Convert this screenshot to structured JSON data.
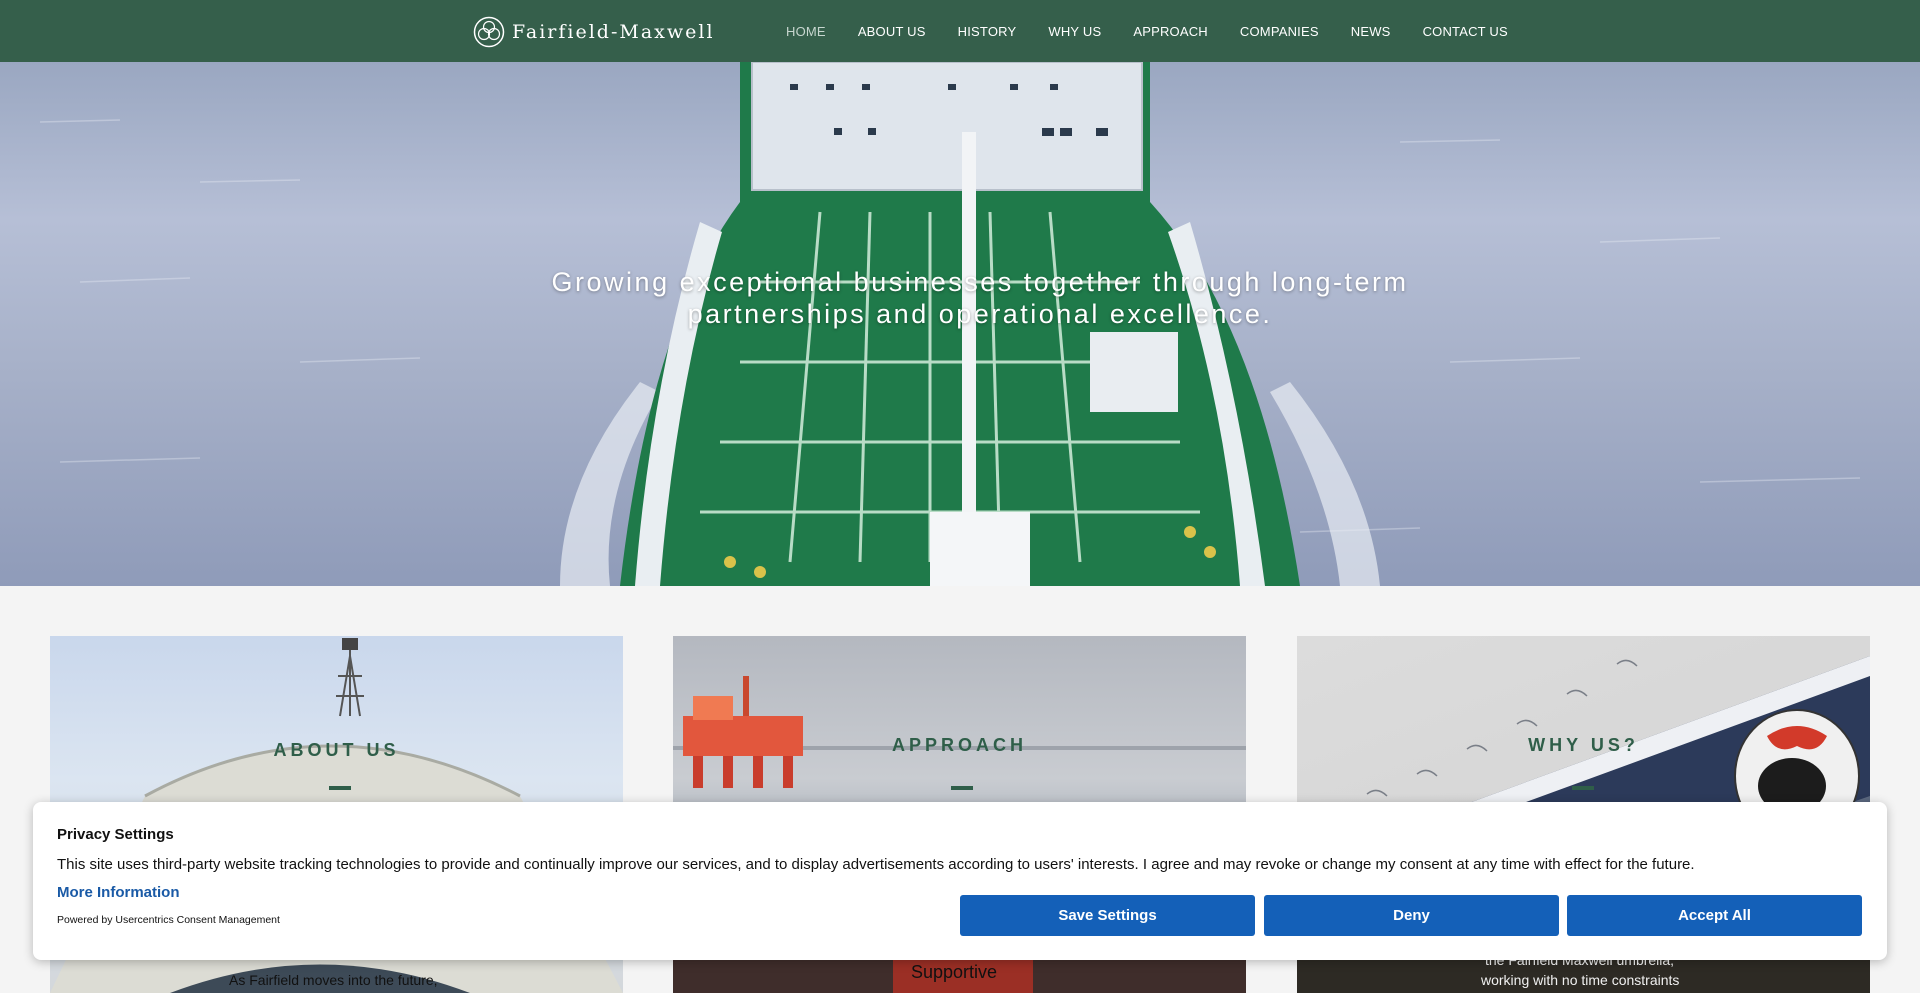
{
  "header": {
    "brand": "Fairfield-Maxwell",
    "nav": [
      {
        "label": "HOME",
        "active": true
      },
      {
        "label": "ABOUT US",
        "active": false
      },
      {
        "label": "HISTORY",
        "active": false
      },
      {
        "label": "WHY US",
        "active": false
      },
      {
        "label": "APPROACH",
        "active": false
      },
      {
        "label": "COMPANIES",
        "active": false
      },
      {
        "label": "NEWS",
        "active": false
      },
      {
        "label": "CONTACT US",
        "active": false
      }
    ]
  },
  "hero": {
    "tagline_line1": "Growing exceptional businesses together through long-term",
    "tagline_line2": "partnerships and operational excellence."
  },
  "cards": {
    "about": {
      "title": "ABOUT US",
      "text": "As Fairfield moves into the future,"
    },
    "approach": {
      "title": "APPROACH",
      "text": "Supportive"
    },
    "why": {
      "title": "WHY US?",
      "text_line1": "the Fairfield Maxwell umbrella,",
      "text_line2": "working with no time constraints"
    }
  },
  "consent": {
    "title": "Privacy Settings",
    "body": "This site uses third-party website tracking technologies to provide and continually improve our services, and to display advertisements according to users' interests. I agree and may revoke or change my consent at any time with effect for the future.",
    "more_info": "More Information",
    "powered_by": "Powered by Usercentrics Consent Management",
    "buttons": {
      "save": "Save Settings",
      "deny": "Deny",
      "accept": "Accept All"
    }
  },
  "colors": {
    "header_bg": "#355f4b",
    "accent_green": "#2f5e49",
    "button_blue": "#1460b8",
    "link_blue": "#1a5aa6"
  }
}
